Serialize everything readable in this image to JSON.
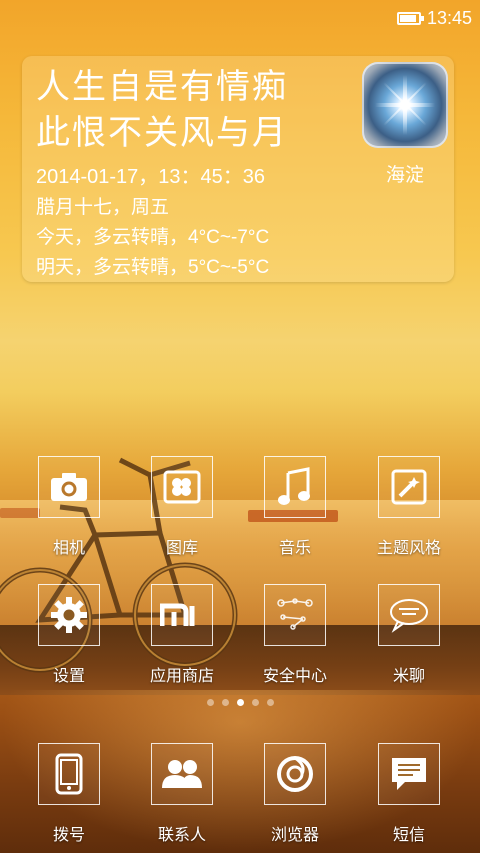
{
  "status_bar": {
    "time": "13:45"
  },
  "widget": {
    "poem_line1": "人生自是有情痴",
    "poem_line2": "此恨不关风与月",
    "datetime": "2014-01-17，13：45：36",
    "lunar": "腊月十七，周五",
    "today": "今天，多云转晴，4°C~-7°C",
    "tomorrow": "明天，多云转晴，5°C~-5°C",
    "city": "海淀",
    "weather_icon": "sun-flare-icon"
  },
  "apps_row1": [
    {
      "label": "相机",
      "icon": "camera-icon"
    },
    {
      "label": "图库",
      "icon": "gallery-icon"
    },
    {
      "label": "音乐",
      "icon": "music-icon"
    },
    {
      "label": "主题风格",
      "icon": "theme-icon"
    }
  ],
  "apps_row2": [
    {
      "label": "设置",
      "icon": "gear-icon"
    },
    {
      "label": "应用商店",
      "icon": "mi-store-icon"
    },
    {
      "label": "安全中心",
      "icon": "security-icon"
    },
    {
      "label": "米聊",
      "icon": "miliao-icon"
    }
  ],
  "page_indicator": {
    "count": 5,
    "active_index": 2
  },
  "dock": [
    {
      "label": "拨号",
      "icon": "phone-icon"
    },
    {
      "label": "联系人",
      "icon": "contacts-icon"
    },
    {
      "label": "浏览器",
      "icon": "browser-icon"
    },
    {
      "label": "短信",
      "icon": "message-icon"
    }
  ]
}
